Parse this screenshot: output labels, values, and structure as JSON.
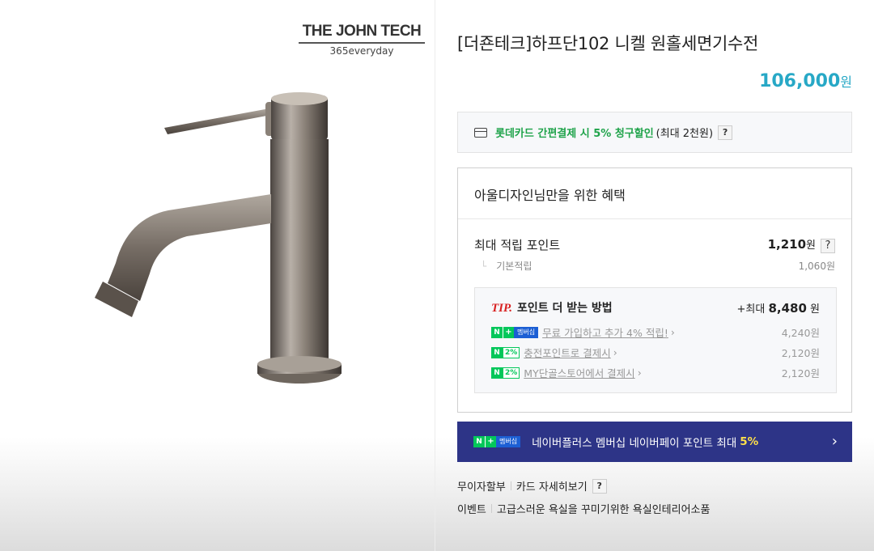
{
  "brand": {
    "name": "THE JOHN TECH",
    "tagline": "365everyday"
  },
  "product": {
    "title": "[더죤테크]하프단102 니켈 원홀세면기수전",
    "price": "106,000",
    "price_unit": "원"
  },
  "card_promo": {
    "highlight": "롯데카드 간편결제 시 5% 청구할인",
    "note": "(최대 2천원)",
    "help": "?"
  },
  "benefit": {
    "header": "아울디자인님만을 위한 혜택",
    "max_point_label": "최대 적립 포인트",
    "max_point_value": "1,210",
    "max_point_unit": "원",
    "help": "?",
    "base_label": "기본적립",
    "base_value": "1,060원",
    "tip": {
      "mark": "TIP.",
      "title": "포인트 더 받는 방법",
      "total_prefix": "+최대",
      "total_value": "8,480",
      "total_unit": "원",
      "rows": [
        {
          "badge_n": "N",
          "badge_b": "+",
          "badge_c": "멤버십",
          "label": "무료 가입하고 추가 4% 적립!",
          "value": "4,240원"
        },
        {
          "badge_n": "N",
          "badge_b": "2%",
          "label": "충전포인트로 결제시",
          "value": "2,120원"
        },
        {
          "badge_n": "N",
          "badge_b": "2%",
          "label": "MY단골스토어에서 결제시",
          "value": "2,120원"
        }
      ]
    }
  },
  "naver_bar": {
    "badge_n": "N",
    "badge_plus": "+",
    "badge_label": "멤버십",
    "text": "네이버플러스 멤버십 네이버페이 포인트 최대",
    "highlight": "5%",
    "chevron": "›"
  },
  "links": {
    "installment": "무이자할부",
    "card_detail": "카드 자세히보기",
    "help": "?",
    "event_label": "이벤트",
    "event_text": "고급스러운 욕실을 꾸미기위한 욕실인테리어소품"
  }
}
